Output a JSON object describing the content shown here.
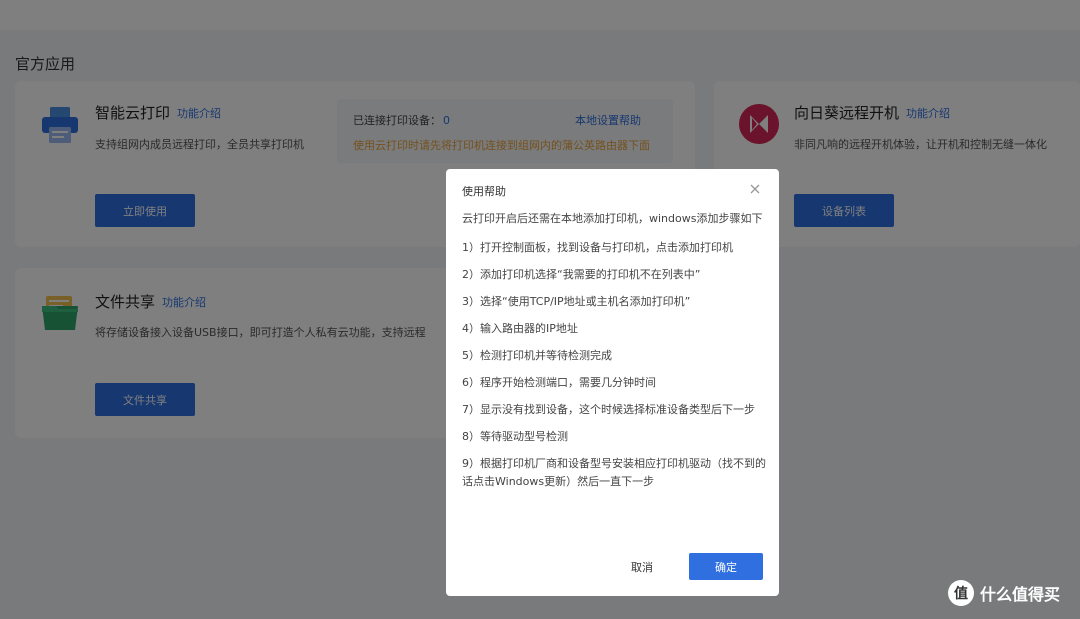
{
  "section_title": "官方应用",
  "cards": {
    "print": {
      "title": "智能云打印",
      "link": "功能介绍",
      "desc": "支持组网内成员远程打印，全员共享打印机",
      "button": "立即使用",
      "connected_label": "已连接打印设备：",
      "connected_count": "0",
      "local_help": "本地设置帮助",
      "warning": "使用云打印时请先将打印机连接到组网内的蒲公英路由器下面",
      "icon": "printer-icon"
    },
    "sunflower": {
      "title": "向日葵远程开机",
      "link": "功能介绍",
      "desc": "非同凡响的远程开机体验，让开机和控制无缝一体化",
      "button": "设备列表",
      "icon": "sunflower-logo-icon"
    },
    "fileshare": {
      "title": "文件共享",
      "link": "功能介绍",
      "desc": "将存储设备接入设备USB接口，即可打造个人私有云功能，支持远程",
      "button": "文件共享",
      "icon": "folder-icon"
    }
  },
  "modal": {
    "title": "使用帮助",
    "intro": "云打印开启后还需在本地添加打印机，windows添加步骤如下",
    "steps": [
      "1）打开控制面板，找到设备与打印机，点击添加打印机",
      "2）添加打印机选择“我需要的打印机不在列表中”",
      "3）选择“使用TCP/IP地址或主机名添加打印机”",
      "4）输入路由器的IP地址",
      "5）检测打印机并等待检测完成",
      "6）程序开始检测端口，需要几分钟时间",
      "7）显示没有找到设备，这个时候选择标准设备类型后下一步",
      "8）等待驱动型号检测",
      "9）根据打印机厂商和设备型号安装相应打印机驱动（找不到的话点击Windows更新）然后一直下一步"
    ],
    "cancel": "取消",
    "ok": "确定"
  },
  "watermark": {
    "logo": "值",
    "text": "什么值得买"
  },
  "colors": {
    "primary": "#2f6fe0",
    "warning": "#e8a33c",
    "overlay": "rgba(0,0,0,0.5)"
  }
}
